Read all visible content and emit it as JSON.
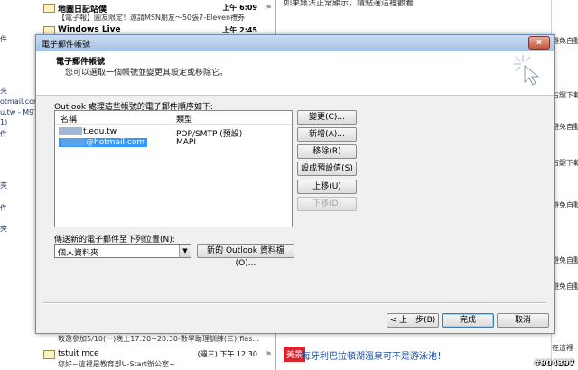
{
  "background": {
    "left_items": [
      "件",
      "夾",
      "otmail.com",
      "u.tw - M971",
      "1)",
      "件",
      "夾",
      "件",
      "夾"
    ],
    "messages": [
      {
        "from": "地圖日記站僕",
        "time": "上午 6:09",
        "subject": "【電子報】圖友限定！邀請MSN朋友～50張7-Eleven禮券"
      },
      {
        "from": "Windows Live",
        "time": "上午 2:45",
        "subject": ""
      },
      {
        "from": "",
        "time": "",
        "subject": "敬邀參加5/10(一)晚上17:20~20:30-數學助理訓練(三)(flas..."
      },
      {
        "from": "tstuit mce",
        "time": "(週三) 下午 12:30",
        "subject": "您好~這裡是教育部U-Start辦公室~"
      }
    ],
    "right_top": "如果無法正常顯示，請點選這裡觀看",
    "right_ad_badge": "美景",
    "right_ad_text": "每牙利巴拉頓湖溫泉可不是游泳池！",
    "far_right_items": [
      "避免自動",
      "右鍵下載",
      "避免自動",
      "右鍵下載",
      "避免自動",
      "避免自動",
      "避免自動",
      "在這裡"
    ],
    "watermark": "#904397"
  },
  "dialog": {
    "title": "電子郵件帳號",
    "close_label": "x",
    "header_title": "電子郵件帳號",
    "header_subtitle": "您可以選取一個帳號並變更其設定或移除它。",
    "list_caption": "Outlook 處理這些帳號的電子郵件順序如下:",
    "columns": {
      "name": "名稱",
      "type": "類型"
    },
    "accounts": [
      {
        "name_suffix": "t.edu.tw",
        "type": "POP/SMTP (預設)"
      },
      {
        "name_suffix": "@hotmail.com",
        "type": "MAPI"
      }
    ],
    "side_buttons": {
      "change": "變更(C)...",
      "new": "新增(A)...",
      "remove": "移除(R)",
      "default": "設成預設值(S)",
      "up": "上移(U)",
      "down": "下移(D)"
    },
    "delivery_caption": "傳送新的電子郵件至下列位置(N):",
    "delivery_value": "個人資料夾",
    "new_datafile": "新的 Outlook 資料檔(O)...",
    "footer": {
      "back": "< 上一步(B)",
      "finish": "完成",
      "cancel": "取消"
    }
  }
}
